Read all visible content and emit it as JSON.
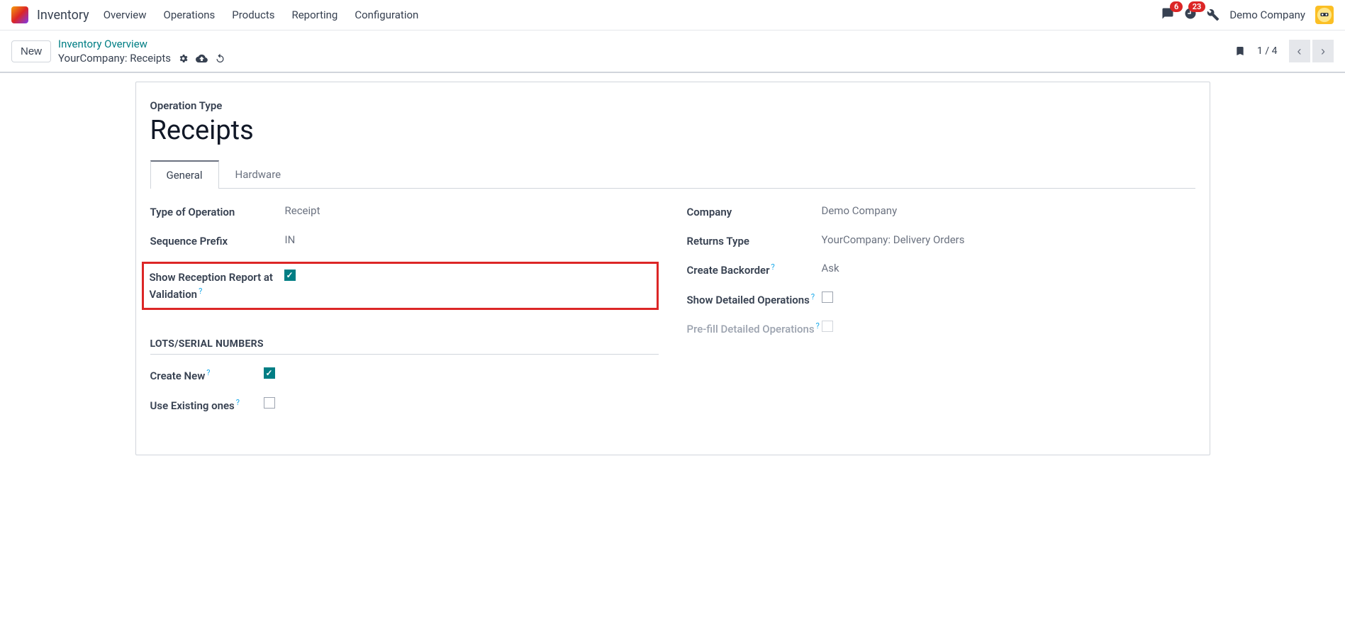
{
  "topbar": {
    "app_name": "Inventory",
    "nav": [
      "Overview",
      "Operations",
      "Products",
      "Reporting",
      "Configuration"
    ],
    "chat_badge": "6",
    "activity_badge": "23",
    "company": "Demo Company"
  },
  "subbar": {
    "new_label": "New",
    "breadcrumb_link": "Inventory Overview",
    "breadcrumb_current": "YourCompany: Receipts",
    "pager": "1 / 4"
  },
  "page": {
    "section_label": "Operation Type",
    "title": "Receipts",
    "tabs": [
      "General",
      "Hardware"
    ]
  },
  "fields_left": {
    "type_of_operation": {
      "label": "Type of Operation",
      "value": "Receipt"
    },
    "sequence_prefix": {
      "label": "Sequence Prefix",
      "value": "IN"
    },
    "show_reception": {
      "label": "Show Reception Report at Validation"
    }
  },
  "fields_right": {
    "company": {
      "label": "Company",
      "value": "Demo Company"
    },
    "returns_type": {
      "label": "Returns Type",
      "value": "YourCompany: Delivery Orders"
    },
    "create_backorder": {
      "label": "Create Backorder",
      "value": "Ask"
    },
    "show_detailed": {
      "label": "Show Detailed Operations"
    },
    "prefill_detailed": {
      "label": "Pre-fill Detailed Operations"
    }
  },
  "lots_section": {
    "heading": "LOTS/SERIAL NUMBERS",
    "create_new": {
      "label": "Create New"
    },
    "use_existing": {
      "label": "Use Existing ones"
    }
  }
}
